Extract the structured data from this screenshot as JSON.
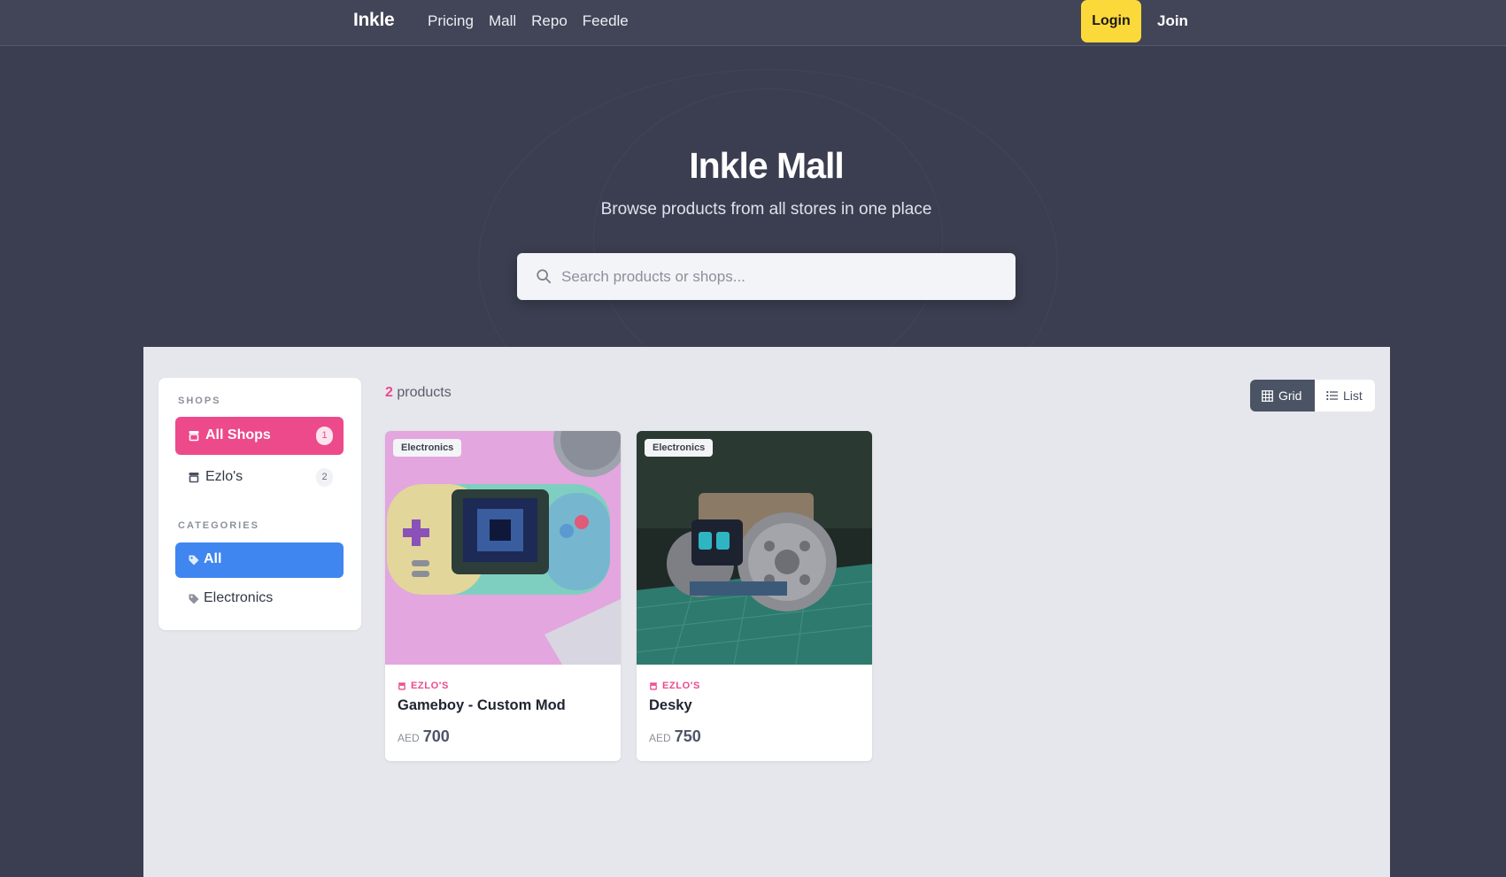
{
  "nav": {
    "brand": "Inkle",
    "links": [
      "Pricing",
      "Mall",
      "Repo",
      "Feedle"
    ],
    "login": "Login",
    "join": "Join"
  },
  "hero": {
    "title": "Inkle Mall",
    "subtitle": "Browse products from all stores in one place",
    "search_placeholder": "Search products or shops..."
  },
  "sidebar": {
    "shops_heading": "SHOPS",
    "shops": [
      {
        "label": "All Shops",
        "count": "1",
        "active": true
      },
      {
        "label": "Ezlo's",
        "count": "2",
        "active": false
      }
    ],
    "categories_heading": "CATEGORIES",
    "categories": [
      {
        "label": "All",
        "active": true
      },
      {
        "label": "Electronics",
        "active": false
      }
    ]
  },
  "results": {
    "count": "2",
    "label": "products"
  },
  "view_toggle": {
    "grid": "Grid",
    "list": "List",
    "selected": "Grid"
  },
  "products": [
    {
      "category": "Electronics",
      "shop": "EZLO'S",
      "name": "Gameboy - Custom Mod",
      "currency": "AED",
      "price": "700"
    },
    {
      "category": "Electronics",
      "shop": "EZLO'S",
      "name": "Desky",
      "currency": "AED",
      "price": "750"
    }
  ],
  "colors": {
    "accent_pink": "#ec4a8b",
    "accent_blue": "#3f86f0",
    "login_yellow": "#fcd93a",
    "page_bg": "#3b3e50"
  }
}
